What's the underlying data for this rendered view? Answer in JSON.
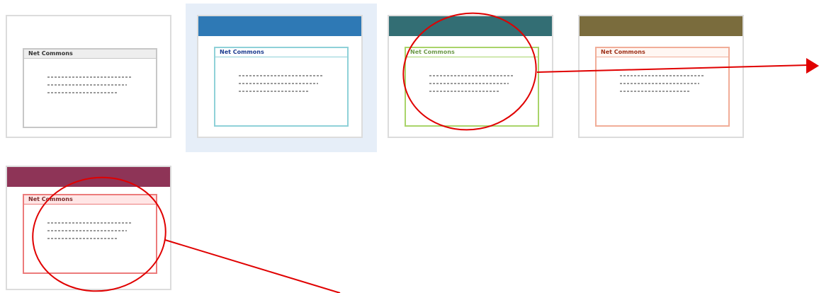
{
  "thumbnails": [
    {
      "title": "Net Commons",
      "header_color": "",
      "frame_color": "#c7c7c7",
      "title_bg": "#eeeeee",
      "title_color": "#333333",
      "selected": false
    },
    {
      "title": "Net Commons",
      "header_color": "#2e79b5",
      "frame_color": "#8fd1d8",
      "title_bg": "#ffffff",
      "title_color": "#1d3c8f",
      "selected": true
    },
    {
      "title": "Net Commons",
      "header_color": "#336e74",
      "frame_color": "#a9d46a",
      "title_bg": "#ffffff",
      "title_color": "#6d9a49",
      "selected": false
    },
    {
      "title": "Net Commons",
      "header_color": "#7a6c3d",
      "frame_color": "#f1ad98",
      "title_bg": "#fff7f3",
      "title_color": "#9d3018",
      "selected": false
    },
    {
      "title": "Net Commons",
      "header_color": "#8e3457",
      "frame_color": "#ec7b7b",
      "title_bg": "#ffe6e6",
      "title_color": "#7a2a2a",
      "selected": false
    }
  ],
  "annotation_color": "#e00000"
}
